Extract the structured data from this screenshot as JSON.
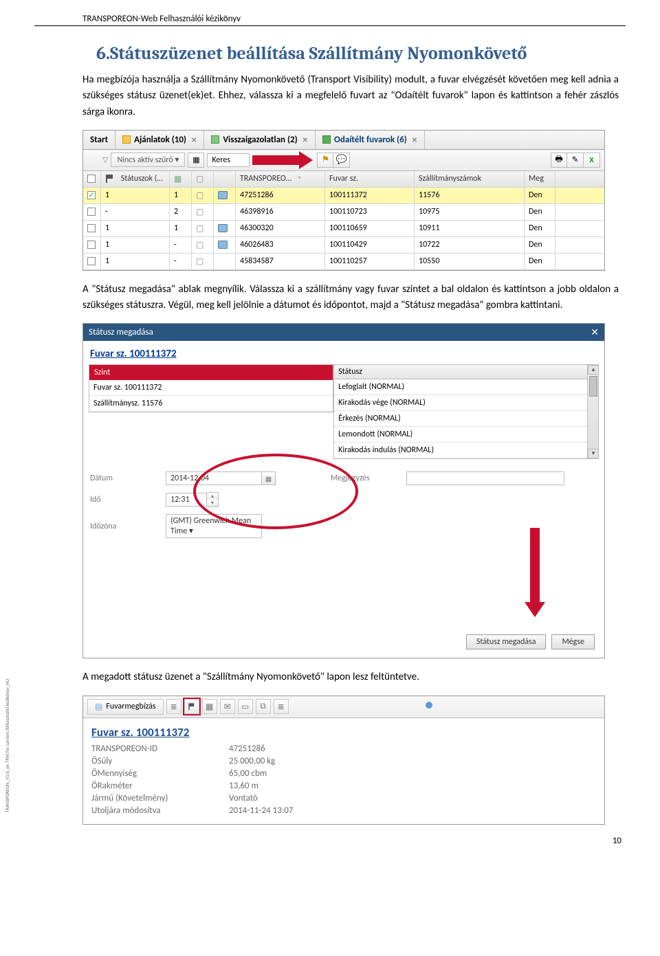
{
  "header": "TRANSPOREON-Web Felhasználói kézikönyv",
  "section_title": "6.Státuszüzenet beállítása Szállítmány Nyomonkövető",
  "para1": "Ha megbízója használja a Szállítmány Nyomonkövető (Transport Visibility) modult, a fuvar elvégzését követően meg kell adnia a szükséges státusz üzenet(ek)et. Ehhez, válassza ki a megfelelő fuvart az \"Odaítélt fuvarok\" lapon és kattintson a fehér zászlós sárga ikonra.",
  "para2": "A \"Státusz megadása\" ablak megnyílik. Válassza ki a szállítmány vagy fuvar szintet a bal oldalon és kattintson a jobb oldalon a szükséges státuszra. Végül, meg kell jelölnie a dátumot és időpontot, majd a \"Státusz megadása\" gombra kattintani.",
  "para3": "A megadott státusz üzenet a \"Szállítmány Nyomonkövető\" lapon lesz feltüntetve.",
  "tabs": {
    "start": "Start",
    "ajanlatok": "Ajánlatok (10)",
    "visszaigazolatlan": "Visszaigazolatlan (2)",
    "odaitelt": "Odaítélt fuvarok (6)"
  },
  "toolbar": {
    "filter": "Nincs aktív szűrő ▾",
    "search_label": "Keres"
  },
  "grid_headers": {
    "statuszok": "Státuszok (…",
    "transporeo": "TRANSPOREO…",
    "fuvar": "Fuvar sz.",
    "szallitmanyszamok": "Szállítmányszámok",
    "meg": "Meg"
  },
  "rows": [
    {
      "chk": true,
      "st": "1",
      "c2": "1",
      "t": "47251286",
      "f": "100111372",
      "s": "11576",
      "m": "Den",
      "print": true
    },
    {
      "chk": false,
      "st": "-",
      "c2": "2",
      "t": "46398916",
      "f": "100110723",
      "s": "10975",
      "m": "Den",
      "print": false
    },
    {
      "chk": false,
      "st": "1",
      "c2": "1",
      "t": "46300320",
      "f": "100110659",
      "s": "10911",
      "m": "Den",
      "print": true
    },
    {
      "chk": false,
      "st": "1",
      "c2": "-",
      "t": "46026483",
      "f": "100110429",
      "s": "10722",
      "m": "Den",
      "print": true
    },
    {
      "chk": false,
      "st": "1",
      "c2": "-",
      "t": "45834587",
      "f": "100110257",
      "s": "10550",
      "m": "Den",
      "print": false
    }
  ],
  "dialog": {
    "title": "Státusz megadása",
    "fuvar_link": "Fuvar sz. 100111372",
    "szint_label": "Szint",
    "status_label": "Státusz",
    "szint_rows": [
      "Fuvar sz. 100111372",
      "Szállítmánysz. 11576"
    ],
    "status_rows": [
      "Lefoglalt (NORMAL)",
      "Kirakodás vége (NORMAL)",
      "Érkezés (NORMAL)",
      "Lemondott (NORMAL)",
      "Kirakodás indulás (NORMAL)"
    ],
    "date_label": "Dátum",
    "date_value": "2014-12-04",
    "time_label": "Idő",
    "time_value": "12:31",
    "tz_label": "Időzóna",
    "tz_value": "(GMT) Greenwich Mean Time",
    "comment_label": "Megjegyzés",
    "btn_submit": "Státusz megadása",
    "btn_cancel": "Mégse"
  },
  "details": {
    "tab_label": "Fuvarmegbízás",
    "heading": "Fuvar sz. 100111372",
    "rows": [
      {
        "k": "TRANSPOREON-ID",
        "v": "47251286"
      },
      {
        "k": "ÖSúly",
        "v": "25 000,00 kg"
      },
      {
        "k": "ÖMennyiség",
        "v": "65,00 cbm"
      },
      {
        "k": "ÖRakméter",
        "v": "13,60 m"
      },
      {
        "k": "Jármű (Követelmény)",
        "v": "Vontató"
      },
      {
        "k": "Utoljára módosítva",
        "v": "2014-11-24 13:07"
      }
    ]
  },
  "side_text": "TRANSPOREON_V1.0_en        TPW for carriers felhasználói kézikönyv_HU",
  "page_number": "10"
}
